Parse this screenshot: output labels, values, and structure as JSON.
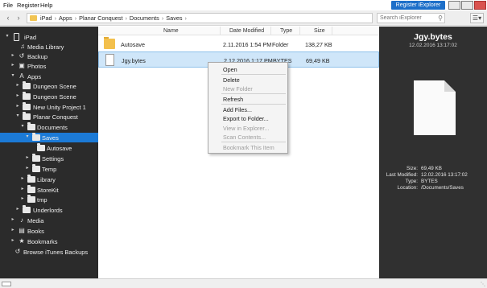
{
  "menu": {
    "file": "File",
    "register": "Register",
    "help": "Help",
    "register_button": "Register iExplorer"
  },
  "toolbar": {
    "back_icon": "chevron-left-icon",
    "forward_icon": "chevron-right-icon",
    "breadcrumbs": [
      "iPad",
      "Apps",
      "Planar Conquest",
      "Documents",
      "Saves"
    ],
    "search_placeholder": "Search iExplorer"
  },
  "sidebar": {
    "items": [
      {
        "label": "iPad",
        "icon": "ipad-icon",
        "expand": "expanded"
      },
      {
        "label": "Media Library",
        "icon": "music-note-icon",
        "expand": "none"
      },
      {
        "label": "Backup",
        "icon": "backup-icon",
        "expand": "collapsed"
      },
      {
        "label": "Photos",
        "icon": "photos-icon",
        "expand": "collapsed"
      },
      {
        "label": "Apps",
        "icon": "apps-icon",
        "expand": "expanded"
      },
      {
        "label": "Dungeon Scene",
        "icon": "folder-icon",
        "expand": "collapsed"
      },
      {
        "label": "Dungeon Scene",
        "icon": "folder-icon",
        "expand": "collapsed"
      },
      {
        "label": "New Unity Project 1",
        "icon": "folder-icon",
        "expand": "collapsed"
      },
      {
        "label": "Planar Conquest",
        "icon": "folder-icon",
        "expand": "expanded"
      },
      {
        "label": "Documents",
        "icon": "folder-icon",
        "expand": "expanded"
      },
      {
        "label": "Saves",
        "icon": "folder-icon",
        "expand": "expanded",
        "selected": true
      },
      {
        "label": "Autosave",
        "icon": "folder-icon",
        "expand": "none"
      },
      {
        "label": "Settings",
        "icon": "folder-icon",
        "expand": "collapsed"
      },
      {
        "label": "Temp",
        "icon": "folder-icon",
        "expand": "collapsed"
      },
      {
        "label": "Library",
        "icon": "folder-icon",
        "expand": "collapsed"
      },
      {
        "label": "StoreKit",
        "icon": "folder-icon",
        "expand": "collapsed"
      },
      {
        "label": "tmp",
        "icon": "folder-icon",
        "expand": "collapsed"
      },
      {
        "label": "Underlords",
        "icon": "folder-icon",
        "expand": "collapsed"
      },
      {
        "label": "Media",
        "icon": "media-icon",
        "expand": "collapsed"
      },
      {
        "label": "Books",
        "icon": "books-icon",
        "expand": "collapsed"
      },
      {
        "label": "Bookmarks",
        "icon": "star-icon",
        "expand": "collapsed"
      },
      {
        "label": "Browse iTunes Backups",
        "icon": "itunes-backup-icon",
        "expand": "none"
      }
    ]
  },
  "files": {
    "columns": {
      "name": "Name",
      "date": "Date Modified",
      "type": "Type",
      "size": "Size"
    },
    "rows": [
      {
        "name": "Autosave",
        "date": "2.11.2016 1:54 PM",
        "type": "Folder",
        "size": "138,27 KB",
        "icon": "folder-icon"
      },
      {
        "name": "Jgy.bytes",
        "date": "2.12.2016 1:17 PM",
        "type": "BYTES",
        "size": "69,49 KB",
        "icon": "file-icon",
        "selected": true
      }
    ]
  },
  "context_menu": {
    "items": [
      {
        "label": "Open",
        "disabled": false
      },
      {
        "label": "Delete",
        "disabled": false
      },
      {
        "label": "New Folder",
        "disabled": true
      },
      {
        "label": "Refresh",
        "disabled": false
      },
      {
        "label": "Add Files...",
        "disabled": false
      },
      {
        "label": "Export to Folder...",
        "disabled": false
      },
      {
        "label": "View in Explorer...",
        "disabled": true
      },
      {
        "label": "Scan Contents...",
        "disabled": true
      },
      {
        "label": "Bookmark This Item",
        "disabled": true
      }
    ]
  },
  "preview": {
    "title": "Jgy.bytes",
    "date": "12.02.2016 13:17:02",
    "details": [
      {
        "key": "Size:",
        "value": "69,49 KB"
      },
      {
        "key": "Last Modified:",
        "value": "12.02.2016 13:17:02"
      },
      {
        "key": "Type:",
        "value": "BYTES"
      },
      {
        "key": "Location:",
        "value": "/Documents/Saves"
      }
    ]
  },
  "colors": {
    "accent": "#1c7ad6",
    "sidebar_bg": "#2b2b2b",
    "preview_bg": "#303030",
    "selection_row": "#cfe6f9",
    "folder": "#f3c04d"
  }
}
